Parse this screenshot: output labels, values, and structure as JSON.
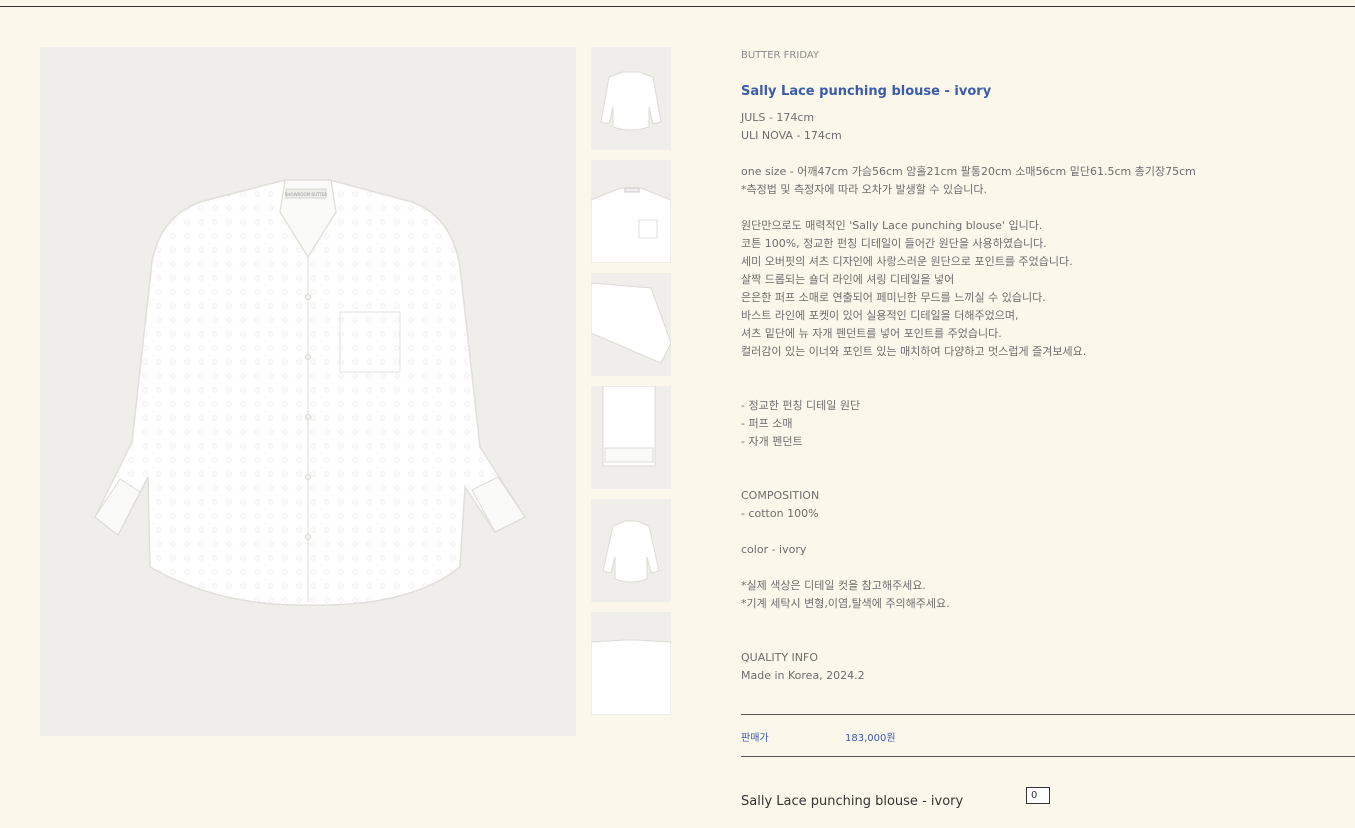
{
  "product": {
    "brand": "BUTTER FRIDAY",
    "name": "Sally Lace punching blouse - ivory",
    "models": [
      "JULS - 174cm",
      "ULI NOVA - 174cm"
    ],
    "size_info": [
      "one size - 어깨47cm 가슴56cm 암홀21cm 팔통20cm 소매56cm 밑단61.5cm 총기장75cm",
      "*측정법 및 측정자에 따라 오차가 발생할 수 있습니다."
    ],
    "description": [
      "원단만으로도 매력적인 'Sally Lace punching blouse' 입니다.",
      "코튼 100%, 정교한 펀칭 디테일이 들어간 원단을 사용하였습니다.",
      "세미 오버핏의 셔츠 디자인에 사랑스러운 원단으로 포인트를 주었습니다.",
      "살짝 드롭되는 숄더 라인에 셔링 디테일을 넣어",
      "은은한 퍼프 소매로 연출되어 페미닌한 무드를 느끼실 수 있습니다.",
      "바스트 라인에 포켓이 있어 실용적인 디테일을 더해주었으며,",
      "셔츠 밑단에 뉴 자개 펜던트를 넣어 포인트를 주었습니다.",
      "컬러감이 있는 이너와 포인트 있는 매치하여 다양하고 멋스럽게 즐겨보세요."
    ],
    "features": [
      "- 정교한 펀칭 디테일 원단",
      "- 퍼프 소매",
      "- 자개 펜던트"
    ],
    "composition_title": "COMPOSITION",
    "composition": "- cotton 100%",
    "color": "color - ivory",
    "care": [
      "*실제 색상은 디테일 컷을 참고해주세요.",
      "*기계 세탁시 변형,이염,탈색에 주의해주세요."
    ],
    "quality_title": "QUALITY INFO",
    "quality": "Made in Korea, 2024.2",
    "price_label": "판매가",
    "price": "183,000원",
    "option_name": "Sally Lace punching blouse - ivory",
    "quantity": "0",
    "main_image_alt": "white lace punching blouse",
    "collar_tag": "SHOWROOM BUTTER"
  },
  "colors": {
    "background": "#fbf8eb",
    "image_bg": "#efeeea",
    "accent": "#3b5bab",
    "text": "#6d6d6d"
  }
}
